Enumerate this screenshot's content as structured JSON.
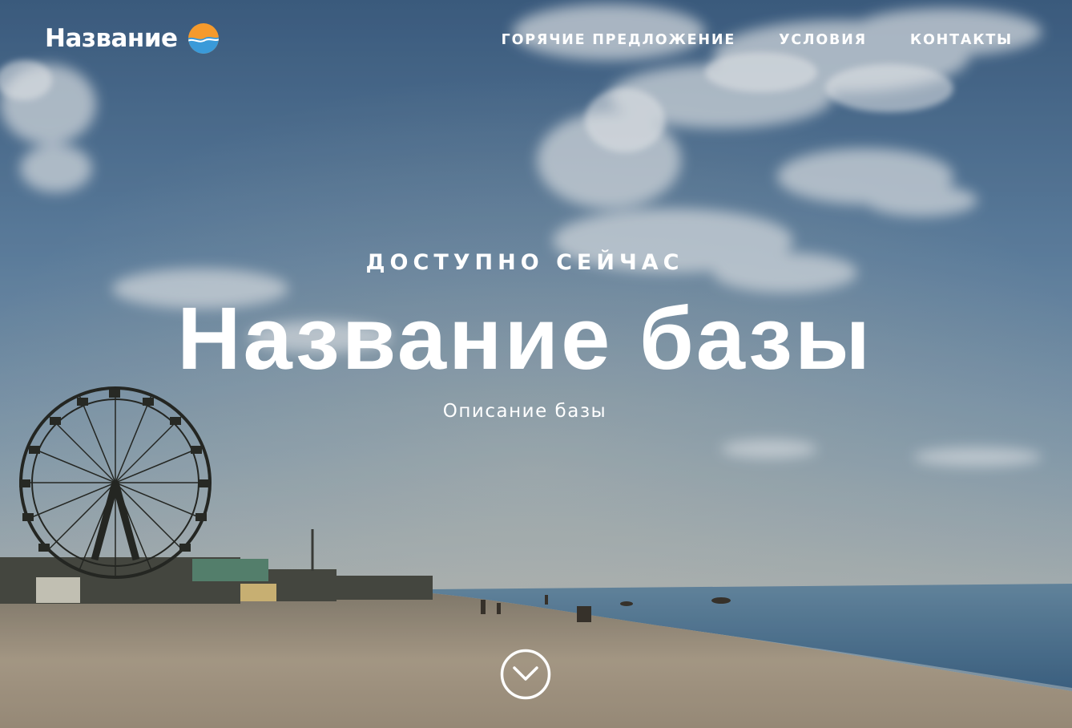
{
  "header": {
    "logo_text": "Название",
    "nav": [
      {
        "label": "ГОРЯЧИЕ ПРЕДЛОЖЕНИЕ"
      },
      {
        "label": "УСЛОВИЯ"
      },
      {
        "label": "КОНТАКТЫ"
      }
    ]
  },
  "hero": {
    "eyebrow": "ДОСТУПНО СЕЙЧАС",
    "title": "Название базы",
    "subtitle": "Описание базы",
    "background": "beach-at-sunset-with-ferris-wheel"
  },
  "icons": {
    "logo_mark": "sun-over-waves-icon",
    "scroll": "chevron-down-circle-icon"
  },
  "colors": {
    "text": "#ffffff",
    "logo_sun": "#f59a2c",
    "logo_wave": "#3a9ad9"
  }
}
